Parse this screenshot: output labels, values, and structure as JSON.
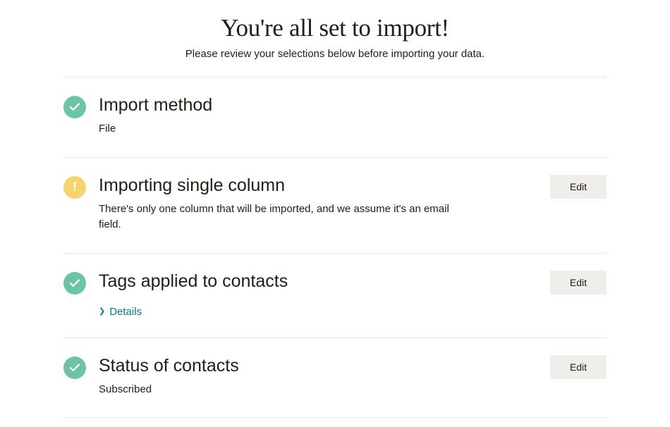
{
  "header": {
    "title": "You're all set to import!",
    "subtitle": "Please review your selections below before importing your data."
  },
  "sections": {
    "import_method": {
      "title": "Import method",
      "description": "File"
    },
    "single_column": {
      "title": "Importing single column",
      "description": "There's only one column that will be imported, and we assume it's an email field.",
      "edit_label": "Edit"
    },
    "tags": {
      "title": "Tags applied to contacts",
      "details_label": "Details",
      "edit_label": "Edit"
    },
    "status": {
      "title": "Status of contacts",
      "description": "Subscribed",
      "edit_label": "Edit"
    }
  }
}
